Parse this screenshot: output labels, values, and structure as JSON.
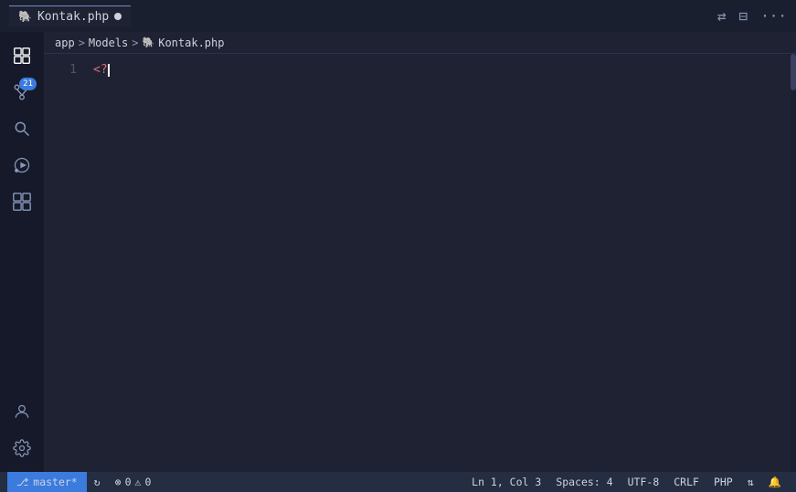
{
  "titlebar": {
    "tab_icon": "🐘",
    "tab_name": "Kontak.php",
    "more_label": "···"
  },
  "breadcrumb": {
    "part1": "app",
    "sep1": ">",
    "part2": "Models",
    "sep2": ">",
    "icon": "🐘",
    "part3": "Kontak.php"
  },
  "editor": {
    "line1_number": "1",
    "line1_code": "<?",
    "cursor": "|"
  },
  "statusbar": {
    "branch": "master*",
    "branch_icon": "⎇",
    "remote_icon": "↻",
    "errors": "0",
    "warnings": "0",
    "error_icon": "⊗",
    "warning_icon": "⚠",
    "ln_col": "Ln 1, Col 3",
    "spaces": "Spaces: 4",
    "encoding": "UTF-8",
    "eol": "CRLF",
    "language": "PHP",
    "notification_icon": "🔔",
    "sync_icon": "⇅"
  },
  "activity": {
    "explorer_icon": "□",
    "source_control_badge": "21",
    "search_icon": "🔍",
    "run_icon": "▷",
    "extensions_icon": "⊞",
    "account_icon": "○",
    "settings_icon": "⚙"
  }
}
